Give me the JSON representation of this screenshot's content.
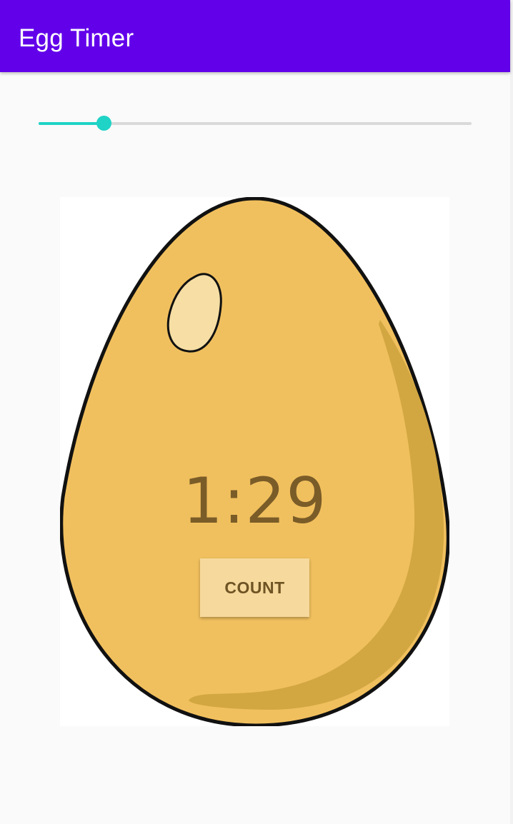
{
  "app_bar": {
    "title": "Egg Timer"
  },
  "slider": {
    "value_fraction": 0.15
  },
  "timer": {
    "display": "1:29"
  },
  "count_button": {
    "label": "COUNT"
  },
  "colors": {
    "app_bar": "#6200ea",
    "accent": "#1fd3c6",
    "egg_fill": "#f1c05e",
    "egg_shadow": "#d2a742",
    "button_bg": "#f6d99c"
  }
}
